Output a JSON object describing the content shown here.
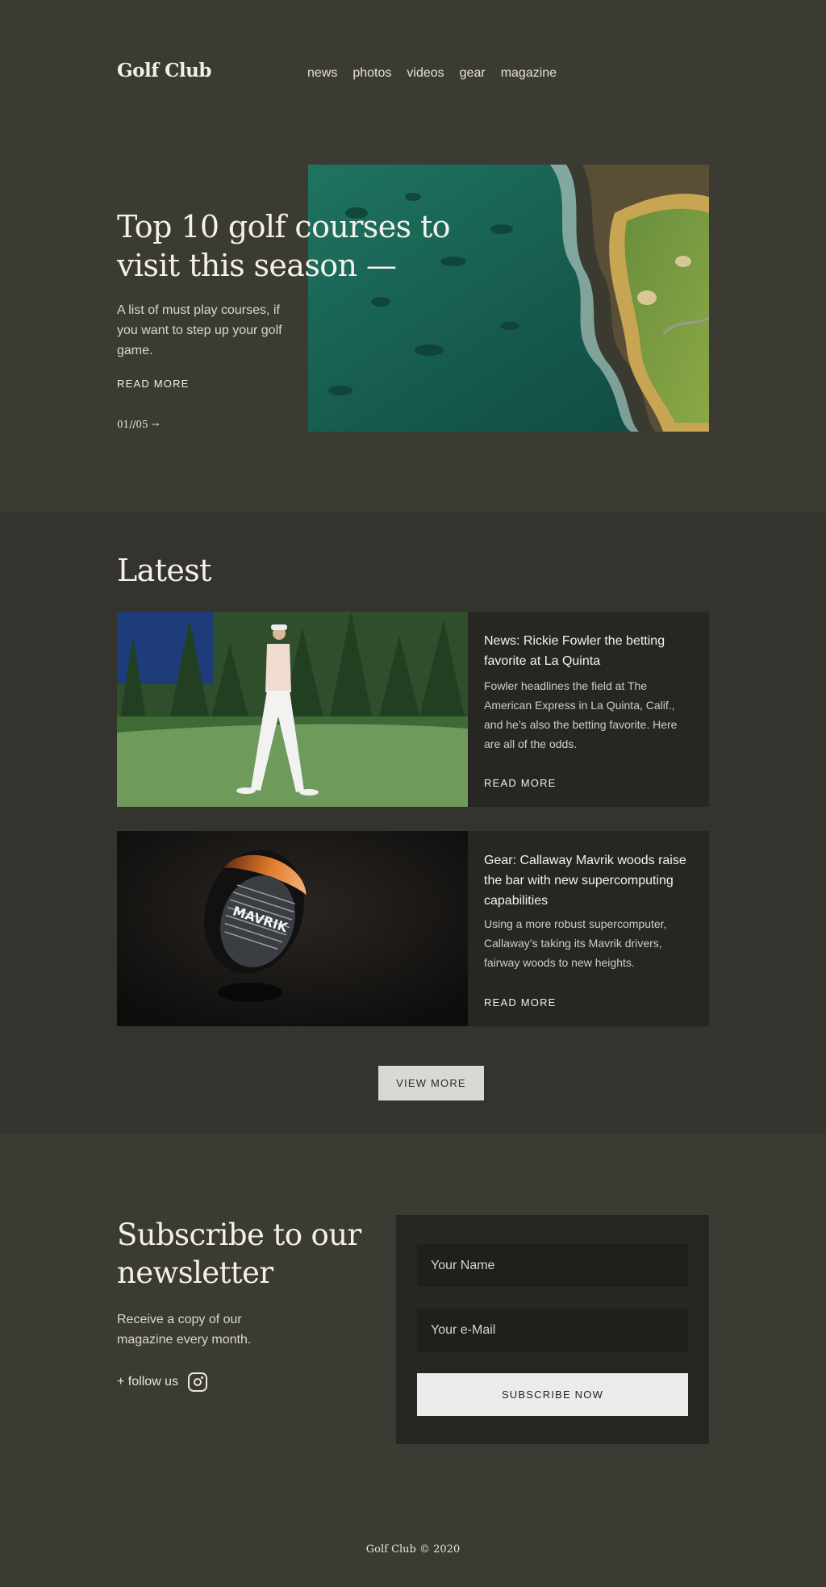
{
  "header": {
    "logo": "Golf Club",
    "nav": [
      "news",
      "photos",
      "videos",
      "gear",
      "magazine"
    ]
  },
  "hero": {
    "title": "Top 10 golf courses to visit this season —",
    "description": "A list of must play courses, if you want to step up your golf game.",
    "read_more": "READ MORE",
    "pager": "01//05 →"
  },
  "latest": {
    "title": "Latest",
    "articles": [
      {
        "title": "News: Rickie Fowler the betting favorite at La Quinta",
        "text": "Fowler headlines the field at The American Express in La Quinta, Calif., and he’s also the betting favorite. Here are all of the odds.",
        "read_more": "READ MORE"
      },
      {
        "title": "Gear: Callaway Mavrik woods raise the bar with new supercomputing capabilities",
        "text": "Using a more robust supercomputer, Callaway’s taking its Mavrik drivers, fairway woods to new heights.",
        "read_more": "READ MORE"
      }
    ],
    "view_more": "VIEW MORE"
  },
  "subscribe": {
    "title": "Subscribe to our newsletter",
    "description": "Receive a copy of our magazine every month.",
    "follow": "+ follow us",
    "name_placeholder": "Your Name",
    "email_placeholder": "Your e-Mail",
    "button": "SUBSCRIBE NOW",
    "club_logo_text": "MAVRIK"
  },
  "footer": {
    "text": "Golf Club © 2020"
  },
  "colors": {
    "page_bg": "#3b3a33",
    "latest_bg": "#34332d",
    "card_bg": "#272622",
    "accent_light": "#ebebea"
  }
}
